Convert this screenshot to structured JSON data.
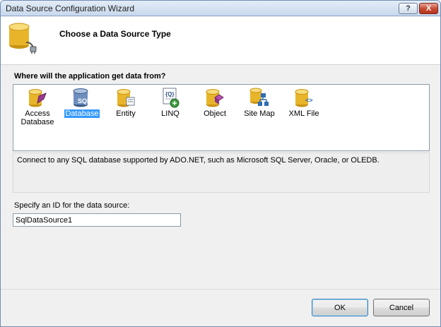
{
  "window": {
    "title": "Data Source Configuration Wizard",
    "help_label": "?",
    "close_label": "X"
  },
  "header": {
    "title": "Choose a Data Source Type"
  },
  "question": "Where will the application get data from?",
  "sources": [
    {
      "label": "Access\nDatabase",
      "icon": "access-database-icon",
      "selected": false
    },
    {
      "label": "Database",
      "icon": "sql-database-icon",
      "selected": true
    },
    {
      "label": "Entity",
      "icon": "entity-icon",
      "selected": false
    },
    {
      "label": "LINQ",
      "icon": "linq-icon",
      "selected": false
    },
    {
      "label": "Object",
      "icon": "object-icon",
      "selected": false
    },
    {
      "label": "Site Map",
      "icon": "site-map-icon",
      "selected": false
    },
    {
      "label": "XML File",
      "icon": "xml-file-icon",
      "selected": false
    }
  ],
  "description": "Connect to any SQL database supported by ADO.NET, such as Microsoft SQL Server, Oracle, or OLEDB.",
  "id_field": {
    "label": "Specify an ID for the data source:",
    "value": "SqlDataSource1"
  },
  "buttons": {
    "ok": "OK",
    "cancel": "Cancel"
  },
  "colors": {
    "selection": "#3399ff",
    "database_gold": "#e8b52a"
  }
}
